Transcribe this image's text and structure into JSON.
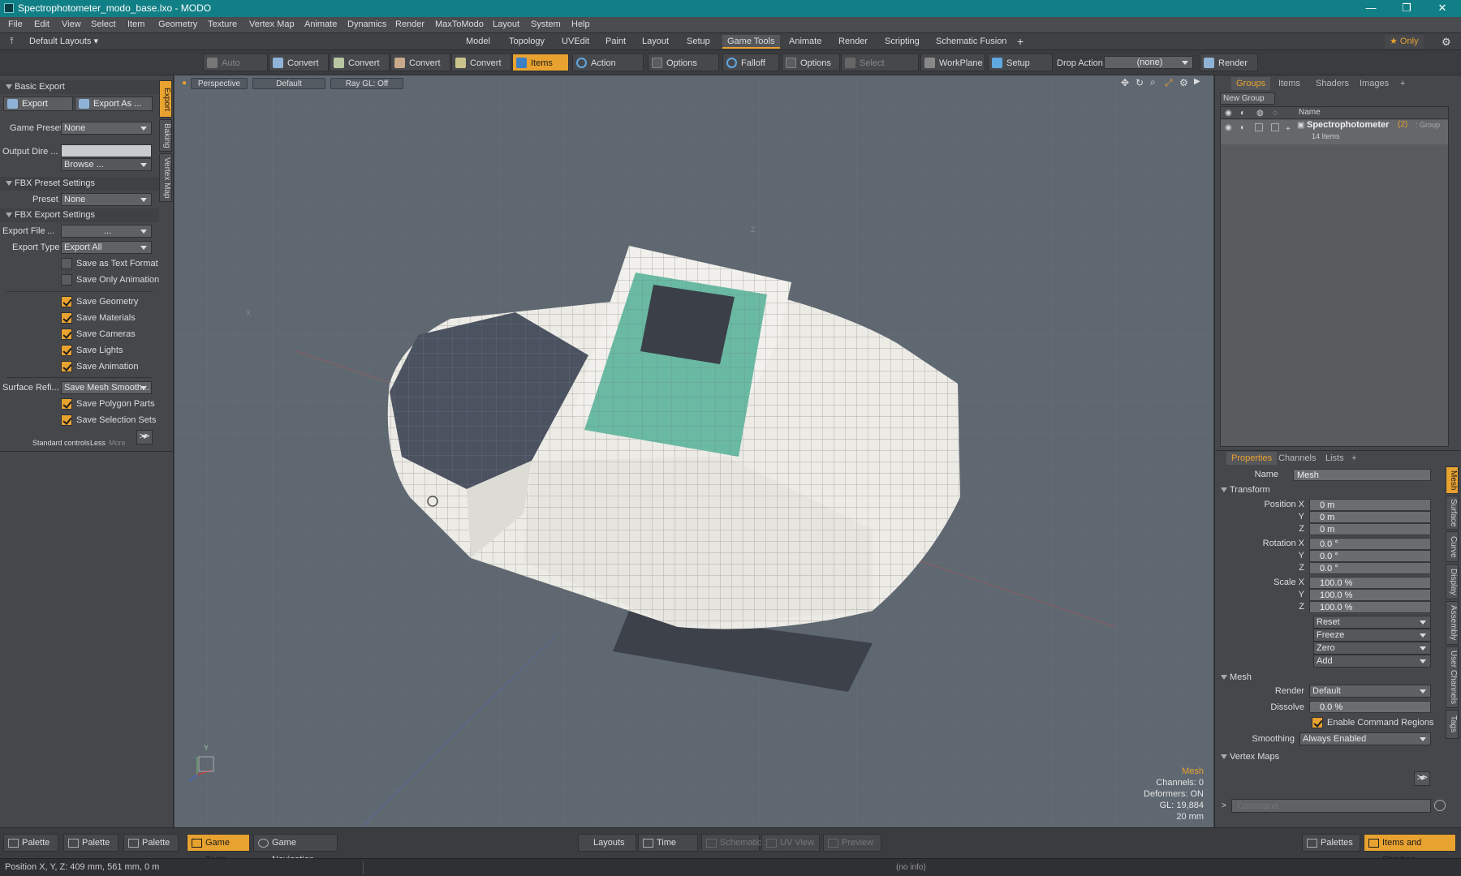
{
  "window": {
    "title": "Spectrophotometer_modo_base.lxo - MODO",
    "min": "—",
    "max": "❐",
    "close": "✕"
  },
  "menu": [
    "File",
    "Edit",
    "View",
    "Select",
    "Item",
    "Geometry",
    "Texture",
    "Vertex Map",
    "Animate",
    "Dynamics",
    "Render",
    "MaxToModo",
    "Layout",
    "System",
    "Help"
  ],
  "layouts_label": "Default Layouts ▾",
  "layout_tabs": [
    "Model",
    "Topology",
    "UVEdit",
    "Paint",
    "Layout",
    "Setup",
    "Game Tools",
    "Animate",
    "Render",
    "Scripting",
    "Schematic Fusion",
    "+"
  ],
  "only_label": "★ Only",
  "toolbar": {
    "auto_select": "Auto Select",
    "convert": "Convert",
    "items": "Items",
    "action_center": "Action Center",
    "options": "Options",
    "falloff": "Falloff",
    "select_through": "Select Through",
    "workplane": "WorkPlane",
    "setup_mode": "Setup Mode",
    "drop_action": "Drop Action",
    "drop_value": "(none)",
    "render": "Render ..."
  },
  "left": {
    "basic_export": "Basic Export",
    "export": "Export",
    "export_as": "Export As ...",
    "game_preset_label": "Game Preset",
    "game_preset": "None",
    "output_dir_label": "Output Dire ...",
    "output_dir": "",
    "browse": "Browse ...",
    "fbx_preset_settings": "FBX Preset Settings",
    "preset_label": "Preset",
    "preset": "None",
    "fbx_export_settings": "FBX Export Settings",
    "export_file_label": "Export File",
    "export_file": "...",
    "export_type_label": "Export Type",
    "export_type": "Export All",
    "checks_off": [
      "Save as Text Format",
      "Save Only Animation"
    ],
    "checks_on": [
      "Save Geometry",
      "Save Materials",
      "Save Cameras",
      "Save Lights",
      "Save Animation"
    ],
    "surface_ref_label": "Surface Refi...",
    "surface_ref": "Save Mesh Smooth...",
    "checks_on2": [
      "Save Polygon Parts",
      "Save Selection Sets"
    ],
    "std_controls": "Standard controls",
    "less": "Less",
    "more": "More",
    "more_btn": ">>",
    "vtabs": [
      "Export",
      "Baking",
      "Vertex Map"
    ]
  },
  "viewport": {
    "view": "Perspective",
    "shading": "Default",
    "raygl": "Ray GL: Off",
    "axis_y": "Y",
    "axis_x": "X",
    "axis_z": "Z",
    "stats": {
      "mesh": "Mesh",
      "channels": "Channels: 0",
      "deformers": "Deformers: ON",
      "gl": "GL: 19,884",
      "unit": "20 mm"
    }
  },
  "right": {
    "tabs": [
      "Groups",
      "Items",
      "Shaders",
      "Images",
      "+"
    ],
    "new_group": "New Group",
    "name_col": "Name",
    "group_name": "Spectrophotometer",
    "group_count": "(2)",
    "group_type": ": Group",
    "group_items": "14 Items",
    "prop_tabs": [
      "Properties",
      "Channels",
      "Lists",
      "+"
    ],
    "name_label": "Name",
    "name_value": "Mesh",
    "transform": "Transform",
    "position": [
      [
        "Position X",
        "0 m"
      ],
      [
        "Y",
        "0 m"
      ],
      [
        "Z",
        "0 m"
      ]
    ],
    "rotation": [
      [
        "Rotation X",
        "0.0 °"
      ],
      [
        "Y",
        "0.0 °"
      ],
      [
        "Z",
        "0.0 °"
      ]
    ],
    "scale": [
      [
        "Scale X",
        "100.0 %"
      ],
      [
        "Y",
        "100.0 %"
      ],
      [
        "Z",
        "100.0 %"
      ]
    ],
    "actions": [
      "Reset",
      "Freeze",
      "Zero",
      "Add"
    ],
    "mesh": "Mesh",
    "render_label": "Render",
    "render_value": "Default",
    "dissolve_label": "Dissolve",
    "dissolve_value": "0.0 %",
    "enable_cmd": "Enable Command Regions",
    "smoothing_label": "Smoothing",
    "smoothing_value": "Always Enabled",
    "vertex_maps": "Vertex Maps",
    "more_btn": ">>",
    "command_placeholder": "Command",
    "vtabs": [
      "Mesh",
      "Surface",
      "Curve",
      "Display",
      "Assembly",
      "User Channels",
      "Tags"
    ]
  },
  "bottom": {
    "palette": "Palette",
    "game_tools": "Game Tools",
    "game_nav": "Game Navigation",
    "layouts": "Layouts",
    "time": "Time",
    "schematic": "Schematic",
    "uv_view": "UV View",
    "preview": "Preview",
    "palettes": "Palettes",
    "items_shading": "Items and Shading"
  },
  "status": {
    "position": "Position X, Y, Z:  409 mm, 561 mm, 0 m",
    "info": "(no info)"
  },
  "colors": {
    "accent": "#e8a230",
    "titlebar": "#117f86",
    "panel": "#6ab9a3"
  }
}
